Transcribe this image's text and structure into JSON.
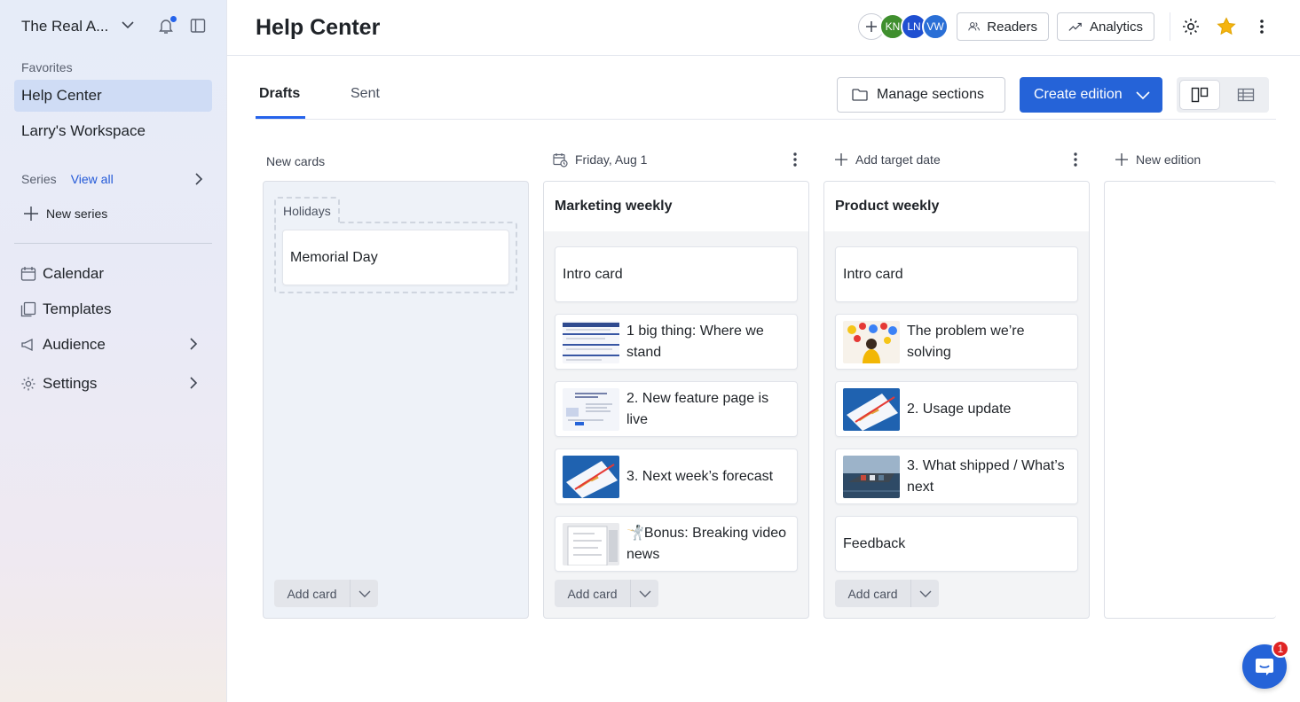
{
  "sidebar": {
    "workspace_name": "The Real A...",
    "favorites_label": "Favorites",
    "favorites": [
      "Help Center",
      "Larry's Workspace"
    ],
    "series_label": "Series",
    "series_view_all": "View all",
    "new_series": "New series",
    "nav": [
      "Calendar",
      "Templates",
      "Audience",
      "Settings"
    ]
  },
  "header": {
    "title": "Help Center",
    "avatars": [
      {
        "initials": "KN",
        "color": "#3f8f2e"
      },
      {
        "initials": "LN",
        "color": "#1f4fd1"
      },
      {
        "initials": "VW",
        "color": "#2a6fd6"
      }
    ],
    "readers_label": "Readers",
    "analytics_label": "Analytics",
    "star_color": "#f5b40f"
  },
  "tabs": {
    "drafts": "Drafts",
    "sent": "Sent"
  },
  "toolbar": {
    "manage_sections": "Manage sections",
    "create_edition": "Create edition"
  },
  "columns": {
    "new_cards": {
      "header": "New cards",
      "group_label": "Holidays",
      "cards": [
        "Memorial Day"
      ],
      "add_card": "Add card"
    },
    "marketing": {
      "date": "Friday, Aug 1",
      "title": "Marketing weekly",
      "cards": [
        "Intro card",
        "1 big thing: Where we stand",
        "2. New feature page is live",
        "3. Next week’s forecast",
        "🤺Bonus: Breaking video news"
      ],
      "add_card": "Add card"
    },
    "product": {
      "date": "Add target date",
      "title": "Product weekly",
      "cards": [
        "Intro card",
        "The problem we’re solving",
        "2. Usage update",
        "3. What shipped / What’s next",
        "Feedback"
      ],
      "add_card": "Add card"
    },
    "new_edition": "New edition"
  },
  "help": {
    "badge_count": "1"
  }
}
